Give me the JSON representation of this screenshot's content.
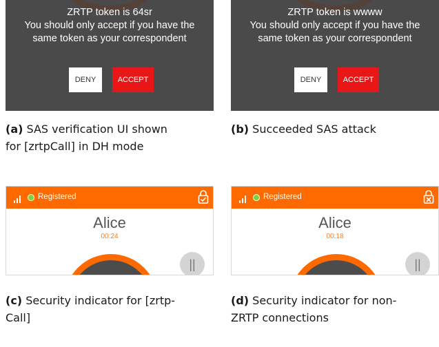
{
  "panel_a": {
    "line1": "ZRTP token is 64sr",
    "line2": "You should only accept if you have the",
    "line3": "same token as your correspondent",
    "deny_label": "DENY",
    "accept_label": "ACCEPT"
  },
  "panel_b": {
    "line1": "ZRTP token is wwww",
    "line2": "You should only accept if you have the",
    "line3": "same token as your correspondent",
    "deny_label": "DENY",
    "accept_label": "ACCEPT"
  },
  "captions": {
    "a_tag": "(a)",
    "a_line1": "SAS verification UI shown",
    "a_line2": "for [zrtpCall] in DH mode",
    "b_tag": "(b)",
    "b_line1": "Succeeded SAS attack",
    "c_tag": "(c)",
    "c_line1": "Security indicator for [zrtp-",
    "c_line2": "Call]",
    "d_tag": "(d)",
    "d_line1": "Security indicator for non-",
    "d_line2": "ZRTP connections"
  },
  "panel_c": {
    "status": "Registered",
    "contact": "Alice",
    "duration": "00:24",
    "pause_label": "||",
    "lock_icon": "lock-check-icon"
  },
  "panel_d": {
    "status": "Registered",
    "contact": "Alice",
    "duration": "00:18",
    "pause_label": "||",
    "lock_icon": "lock-x-icon"
  },
  "colors": {
    "dialog_bg": "#4a4a4a",
    "accept": "#e81616",
    "brand_orange": "#ff6a00",
    "registered_dot": "#7bd43a"
  }
}
